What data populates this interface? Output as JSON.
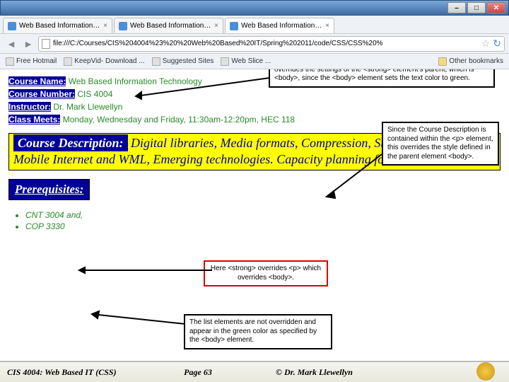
{
  "window": {
    "tabs": [
      {
        "label": "Web Based Information T..."
      },
      {
        "label": "Web Based Information T..."
      },
      {
        "label": "Web Based Information T...",
        "active": true
      }
    ],
    "url": "file:///C:/Courses/CIS%204004%23%20%20Web%20Based%20IT/Spring%202011/code/CSS/CSS%20%",
    "bookmarks": [
      {
        "label": "Free Hotmail"
      },
      {
        "label": "KeepVid- Download ..."
      },
      {
        "label": "Suggested Sites"
      },
      {
        "label": "Web Slice ..."
      },
      {
        "label": "Other bookmarks"
      }
    ]
  },
  "course": {
    "name_label": "Course Name:",
    "name": " Web Based Information Technology",
    "number_label": "Course Number:",
    "number": " CIS 4004",
    "instructor_label": "Instructor:",
    "instructor": " Dr. Mark Llewellyn",
    "meets_label": "Class Meets:",
    "meets": " Monday, Wednesday and Friday, 11:30am-12:20pm, HEC 118"
  },
  "description": {
    "label": "Course Description:",
    "text": " Digital libraries, Media formats, Compression, Streaming Media, Mobile Internet and WML, Emerging technologies. Capacity planning for web services."
  },
  "prereq": {
    "label": "Prerequisites:",
    "items": [
      "CNT 3004 and,",
      "COP 3330"
    ]
  },
  "callouts": {
    "c1": "Notice that all text within the <strong> elements is white which overrides the settings of the <strong> element's parent, which is <body>, since the <body> element sets the text color to green.",
    "c2": "Since the Course Description is contained within the <p> element, this overrides the style defined in the parent element <body>.",
    "c3": "Here <strong> overrides <p> which overrides <body>.",
    "c4": "The list elements are not overridden and appear in the green color as specified by the <body> element."
  },
  "footer": {
    "left": "CIS 4004: Web Based IT (CSS)",
    "center": "Page 63",
    "right": "© Dr. Mark Llewellyn"
  }
}
